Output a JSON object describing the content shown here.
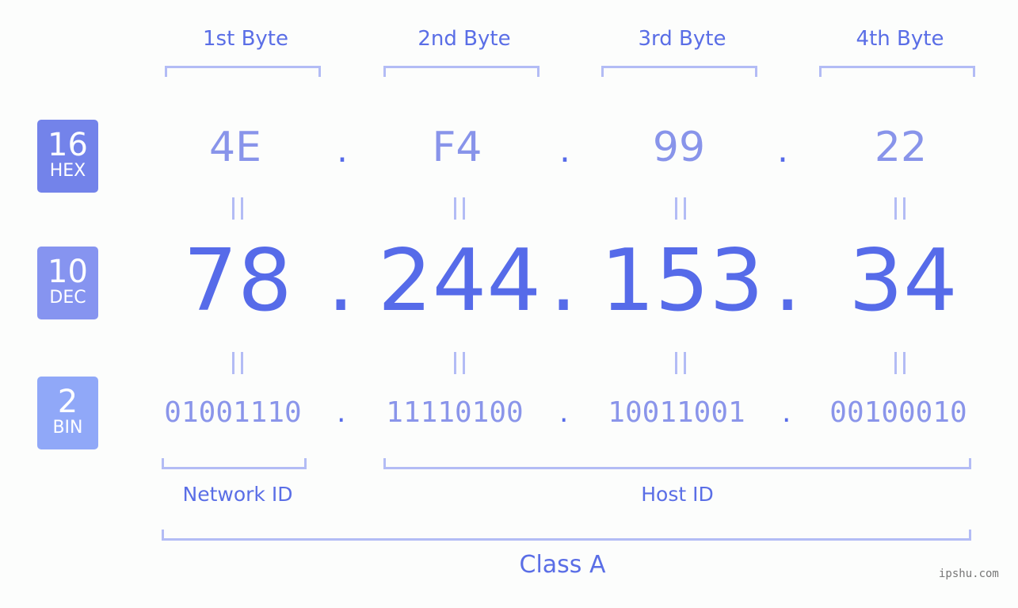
{
  "byte_headers": [
    "1st Byte",
    "2nd Byte",
    "3rd Byte",
    "4th Byte"
  ],
  "badges": {
    "hex": {
      "number": "16",
      "label": "HEX",
      "color": "#7383ea"
    },
    "dec": {
      "number": "10",
      "label": "DEC",
      "color": "#8694f0"
    },
    "bin": {
      "number": "2",
      "label": "BIN",
      "color": "#90a8f8"
    }
  },
  "hex_octets": [
    "4E",
    "F4",
    "99",
    "22"
  ],
  "dec_octets": [
    "78",
    "244",
    "153",
    "34"
  ],
  "bin_octets": [
    "01001110",
    "11110100",
    "10011001",
    "00100010"
  ],
  "separator": ".",
  "network_label": "Network ID",
  "host_label": "Host ID",
  "class_label": "Class A",
  "watermark": "ipshu.com",
  "colors": {
    "primary": "#566be9",
    "light": "#8894ea",
    "bracket": "#b3bcf5"
  }
}
